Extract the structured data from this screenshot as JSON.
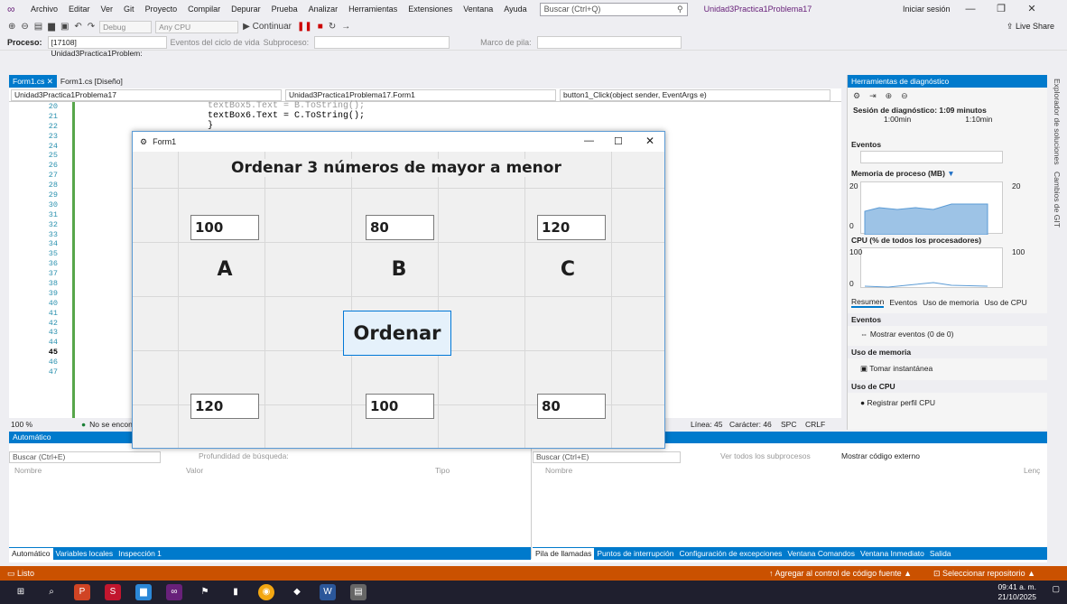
{
  "menu": {
    "items": [
      "Archivo",
      "Editar",
      "Ver",
      "Git",
      "Proyecto",
      "Compilar",
      "Depurar",
      "Prueba",
      "Analizar",
      "Herramientas",
      "Extensiones",
      "Ventana",
      "Ayuda"
    ],
    "search_placeholder": "Buscar (Ctrl+Q)",
    "app_title": "Unidad3Practica1Problema17",
    "signin": "Iniciar sesión"
  },
  "toolbar": {
    "config": "Debug",
    "platform": "Any CPU",
    "continue": "Continuar",
    "liveshare": "Live Share"
  },
  "procbar": {
    "label": "Proceso:",
    "process": "[17108] Unidad3Practica1Problem:",
    "lifecycle": "Eventos del ciclo de vida",
    "thread": "Subproceso:",
    "stack": "Marco de pila:"
  },
  "doctabs": [
    "Form1.cs",
    "Form1.cs [Diseño]"
  ],
  "navbar": {
    "project": "Unidad3Practica1Problema17",
    "class": "Unidad3Practica1Problema17.Form1",
    "method": "button1_Click(object sender, EventArgs e)"
  },
  "editor": {
    "line_numbers": [
      "20",
      "21",
      "22",
      "23",
      "24",
      "25",
      "26",
      "27",
      "28",
      "29",
      "30",
      "31",
      "32",
      "33",
      "34",
      "35",
      "36",
      "37",
      "38",
      "39",
      "40",
      "41",
      "42",
      "43",
      "44",
      "45",
      "46",
      "47"
    ],
    "code": [
      "textBox5.Text = B.ToString();",
      "textBox6.Text = C.ToString();",
      "}"
    ],
    "zoom": "100 %",
    "issues": "No se encon",
    "line": "Línea: 45",
    "char": "Carácter: 46",
    "spc": "SPC",
    "crlf": "CRLF"
  },
  "form": {
    "title": "Form1",
    "heading": "Ordenar 3 números de mayor a menor",
    "inputs": [
      "100",
      "80",
      "120"
    ],
    "labels": [
      "A",
      "B",
      "C"
    ],
    "button": "Ordenar",
    "outputs": [
      "120",
      "100",
      "80"
    ]
  },
  "diag": {
    "title": "Herramientas de diagnóstico",
    "session": "Sesión de diagnóstico: 1:09 minutos",
    "t1": "1:00min",
    "t2": "1:10min",
    "events": "Eventos",
    "memory": "Memoria de proceso (MB)",
    "mem_max": "20",
    "mem_min": "0",
    "cpu": "CPU (% de todos los procesadores)",
    "cpu_max": "100",
    "cpu_min": "0",
    "tabs": [
      "Resumen",
      "Eventos",
      "Uso de memoria",
      "Uso de CPU"
    ],
    "sec_events": "Eventos",
    "show_events": "Mostrar eventos (0 de 0)",
    "sec_memory": "Uso de memoria",
    "snapshot": "Tomar instantánea",
    "sec_cpu": "Uso de CPU",
    "profile": "Registrar perfil CPU",
    "sidestrip": [
      "Explorador de soluciones",
      "Cambios de GIT"
    ]
  },
  "bottom": {
    "auto_title": "Automático",
    "search": "Buscar (Ctrl+E)",
    "depth": "Profundidad de búsqueda:",
    "cols": [
      "Nombre",
      "Valor",
      "Tipo"
    ],
    "left_tabs": [
      "Automático",
      "Variables locales",
      "Inspección 1"
    ],
    "all_threads": "Ver todos los subprocesos",
    "external": "Mostrar código externo",
    "right_cols": [
      "Nombre",
      "Lenç"
    ],
    "right_tabs": [
      "Pila de llamadas",
      "Puntos de interrupción",
      "Configuración de excepciones",
      "Ventana Comandos",
      "Ventana Inmediato",
      "Salida"
    ]
  },
  "status": {
    "ready": "Listo",
    "source_control": "Agregar al control de código fuente",
    "repo": "Seleccionar repositorio"
  },
  "taskbar": {
    "time": "09:41 a. m.",
    "date": "21/10/2025"
  }
}
